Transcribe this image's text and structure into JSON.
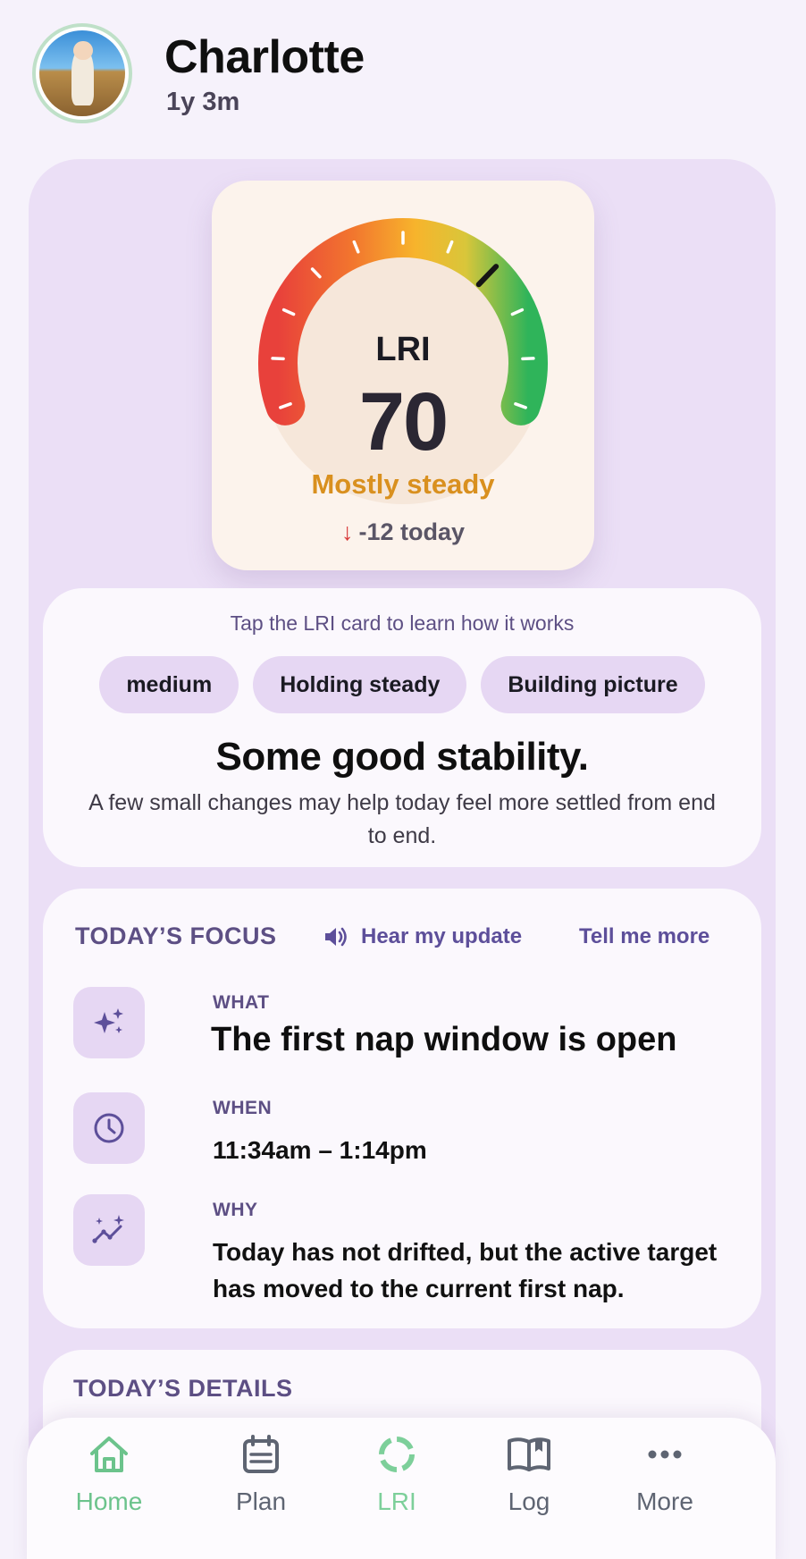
{
  "profile": {
    "name": "Charlotte",
    "age": "1y 3m"
  },
  "lri": {
    "label": "LRI",
    "value": "70",
    "status": "Mostly steady",
    "change": "-12 today",
    "gauge_value": 70,
    "gauge_max": 100,
    "status_color": "#d9901f"
  },
  "summary": {
    "hint": "Tap the LRI card to learn how it works",
    "chips": [
      "medium",
      "Holding steady",
      "Building picture"
    ],
    "headline": "Some good stability.",
    "body": "A few small changes may help today feel more settled from end to end."
  },
  "focus": {
    "title": "TODAY’S FOCUS",
    "hear_label": "Hear my update",
    "tell_label": "Tell me more",
    "what": {
      "label": "WHAT",
      "value": "The first nap window is open",
      "icon": "sparkles-icon"
    },
    "when": {
      "label": "WHEN",
      "value": "11:34am – 1:14pm",
      "icon": "clock-icon"
    },
    "why": {
      "label": "WHY",
      "value": "Today has not drifted, but the active target has moved to the current first nap.",
      "icon": "trend-sparkle-icon"
    }
  },
  "details": {
    "title": "TODAY’S DETAILS"
  },
  "nav": {
    "items": [
      {
        "label": "Home",
        "icon": "home-icon",
        "active": true
      },
      {
        "label": "Plan",
        "icon": "calendar-icon",
        "active": false
      },
      {
        "label": "LRI",
        "icon": "ring-icon",
        "active": false
      },
      {
        "label": "Log",
        "icon": "book-icon",
        "active": false
      },
      {
        "label": "More",
        "icon": "more-icon",
        "active": false
      }
    ]
  },
  "colors": {
    "accent": "#5d4f84",
    "active_nav": "#6cc38c",
    "background": "#f6f2fb",
    "panel": "#ebdff6"
  }
}
